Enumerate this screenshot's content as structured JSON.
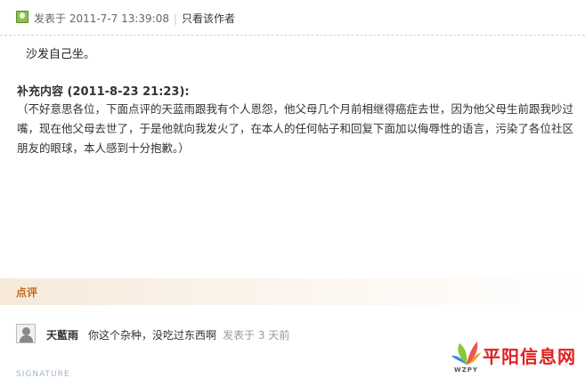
{
  "post": {
    "posted_label": "发表于 2011-7-7 13:39:08",
    "separator": "|",
    "author_only_label": "只看该作者",
    "body": "沙发自己坐。",
    "supplement_title": "补充内容 (2011-8-23 21:23):",
    "supplement_text": "（不好意思各位，下面点评的天蓝雨跟我有个人恩怨，他父母几个月前相继得癌症去世，因为他父母生前跟我吵过嘴，现在他父母去世了，于是他就向我发火了，在本人的任何帖子和回复下面加以侮辱性的语言，污染了各位社区朋友的眼球，本人感到十分抱歉。）"
  },
  "comments": {
    "section_title": "点评",
    "items": [
      {
        "author": "天藍雨",
        "text": "你这个杂种，没吃过东西啊",
        "time": "发表于 3 天前"
      }
    ]
  },
  "signature": {
    "label": "SIGNATURE"
  },
  "watermark": {
    "site_name": "平阳信息网",
    "abbr": "WZPY"
  },
  "colors": {
    "accent_orange": "#c46a1f",
    "watermark_red": "#e02020",
    "online_icon_green": "#8bc34a"
  },
  "icons": {
    "online": "user-online-icon",
    "avatar": "default-avatar-icon",
    "logo": "leaf-logo-icon"
  }
}
